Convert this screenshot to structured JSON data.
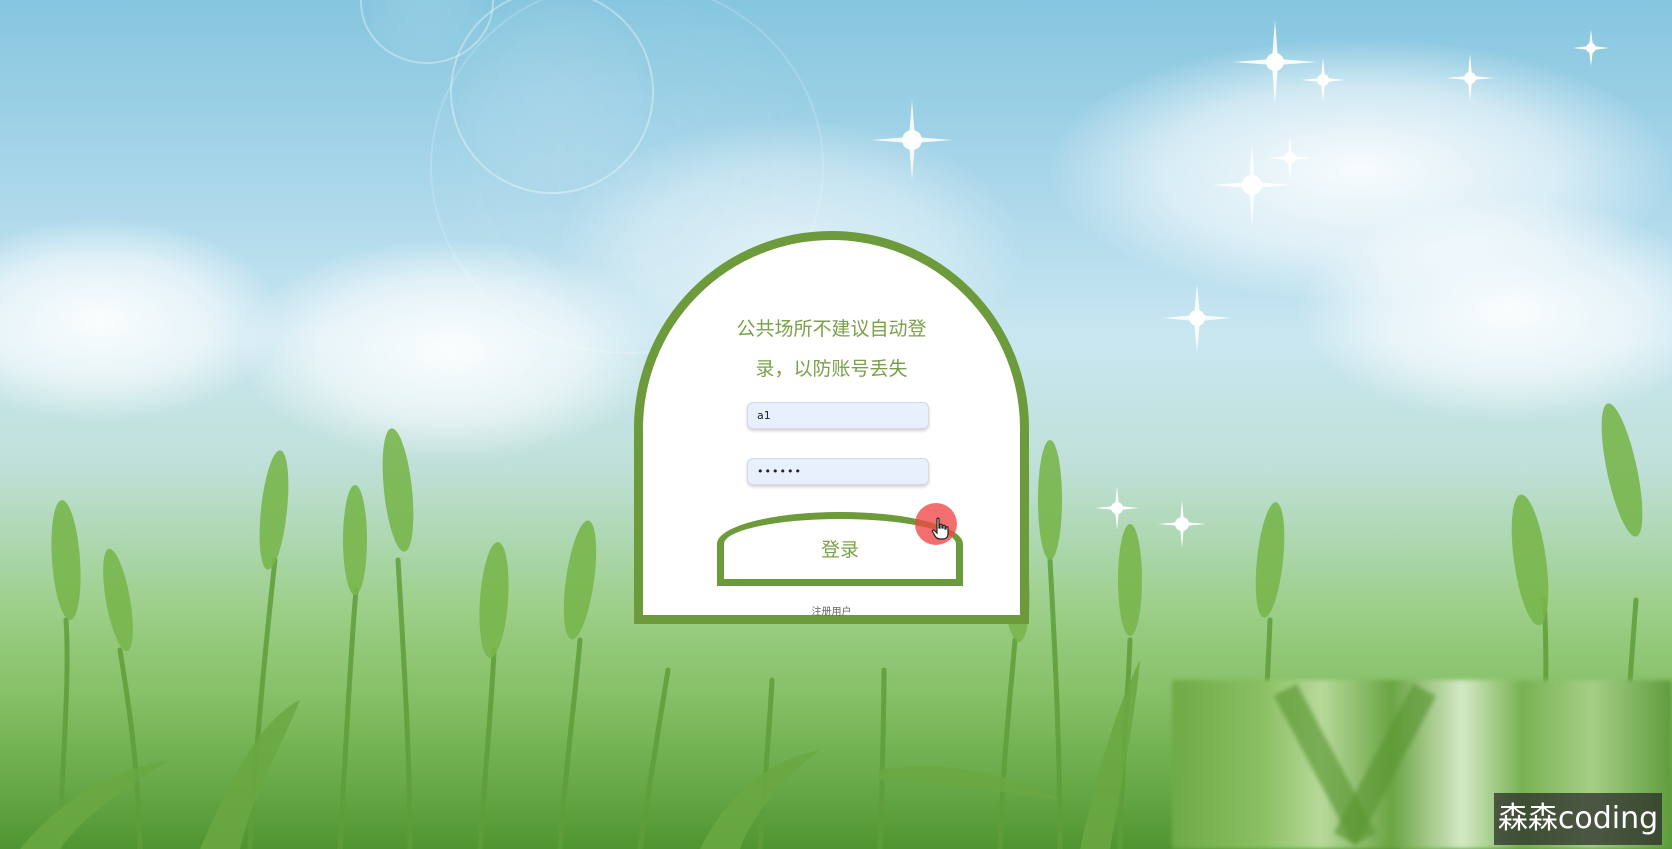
{
  "login": {
    "title_line1": "公共场所不建议自动登",
    "title_line2": "录，以防账号丢失",
    "username_value": "a1",
    "password_value": "••••••",
    "login_button": "登录",
    "register_link": "注册用户"
  },
  "watermark": {
    "text": "森森coding"
  },
  "icons": {
    "cursor": "hand-pointer-icon",
    "sparkle": "sparkle-icon"
  },
  "colors": {
    "accent_green": "#6d9a3a",
    "text_green": "#7aa04a",
    "input_bg": "#e8f0fe",
    "cursor_highlight": "#f04646"
  }
}
